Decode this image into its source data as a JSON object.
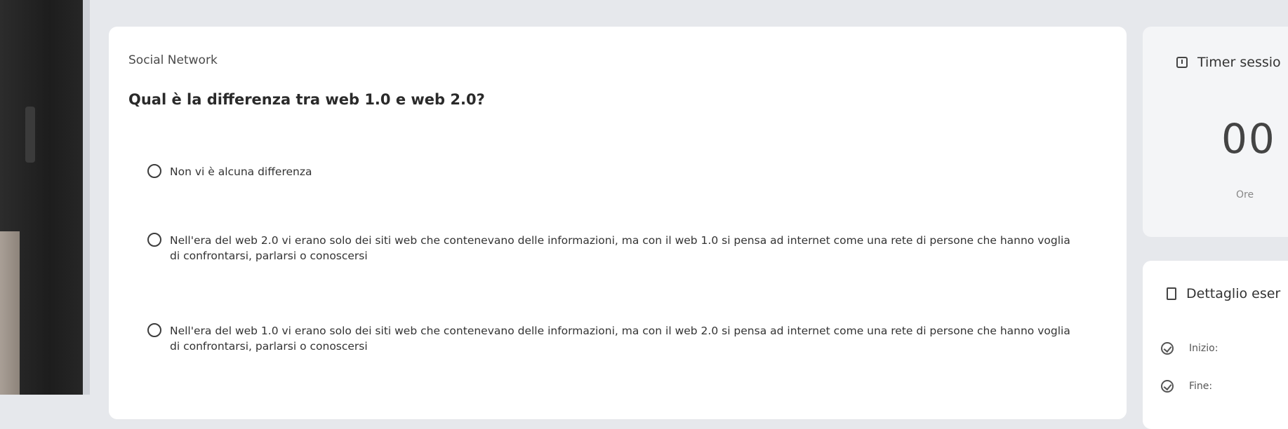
{
  "quiz": {
    "subject": "Social Network",
    "question": "Qual è la differenza tra web 1.0 e web 2.0?",
    "options": [
      {
        "label": "Non vi è alcuna differenza"
      },
      {
        "label": "Nell'era del web 2.0 vi erano solo dei siti web che contenevano delle informazioni, ma con il web 1.0 si pensa ad internet come una rete di persone che hanno voglia di confrontarsi, parlarsi o conoscersi"
      },
      {
        "label": "Nell'era del web 1.0 vi erano solo dei siti web che contenevano delle informazioni, ma con il web 2.0 si pensa ad internet come una rete di persone che hanno voglia di confrontarsi, parlarsi o conoscersi"
      }
    ]
  },
  "timer": {
    "title": "Timer sessio",
    "hours": "00",
    "separator": ":",
    "hours_label": "Ore",
    "icon": "timer-icon"
  },
  "details": {
    "title": "Dettaglio eser",
    "icon": "document-icon",
    "start_label": "Inizio:",
    "end_label": "Fine:"
  }
}
